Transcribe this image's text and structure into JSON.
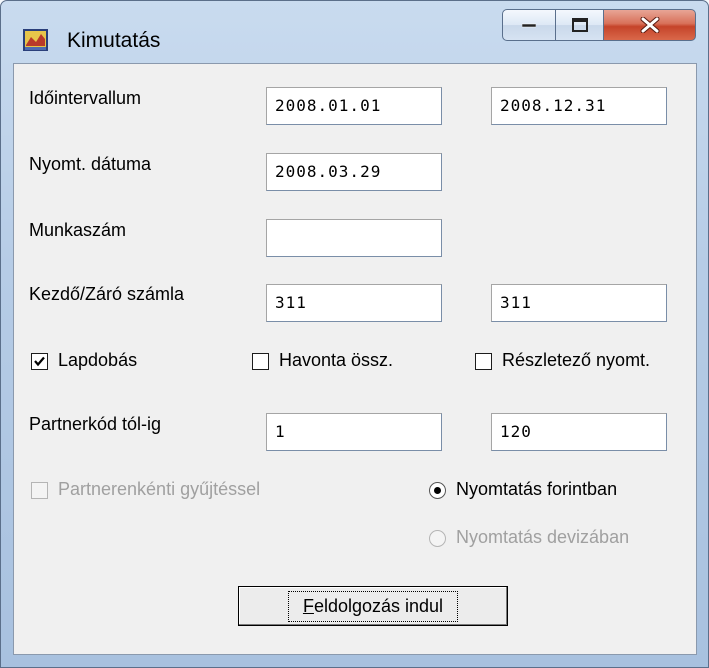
{
  "window": {
    "title": "Kimutatás",
    "controls": {
      "minimize": "minimize",
      "maximize": "maximize",
      "close": "close"
    }
  },
  "form": {
    "interval": {
      "label": "Időintervallum",
      "from": "2008.01.01",
      "to": "2008.12.31"
    },
    "print_date": {
      "label": "Nyomt. dátuma",
      "value": "2008.03.29"
    },
    "job_number": {
      "label": "Munkaszám",
      "value": ""
    },
    "account_range": {
      "label": "Kezdő/Záró számla",
      "from": "311",
      "to": "311"
    },
    "checkboxes": {
      "page_break": {
        "label": "Lapdobás",
        "checked": true
      },
      "monthly_sum": {
        "label": "Havonta össz.",
        "checked": false
      },
      "detailed_print": {
        "label": "Részletező nyomt.",
        "checked": false
      }
    },
    "partner_range": {
      "label": "Partnerkód tól-ig",
      "from": "1",
      "to": "120"
    },
    "partner_collect": {
      "label": "Partnerenkénti gyűjtéssel",
      "checked": false,
      "enabled": false
    },
    "print_currency": {
      "forint": {
        "label": "Nyomtatás forintban",
        "selected": true
      },
      "foreign": {
        "label": "Nyomtatás devizában",
        "selected": false,
        "enabled": false
      }
    },
    "submit": {
      "accel": "F",
      "rest": "eldolgozás indul"
    }
  }
}
